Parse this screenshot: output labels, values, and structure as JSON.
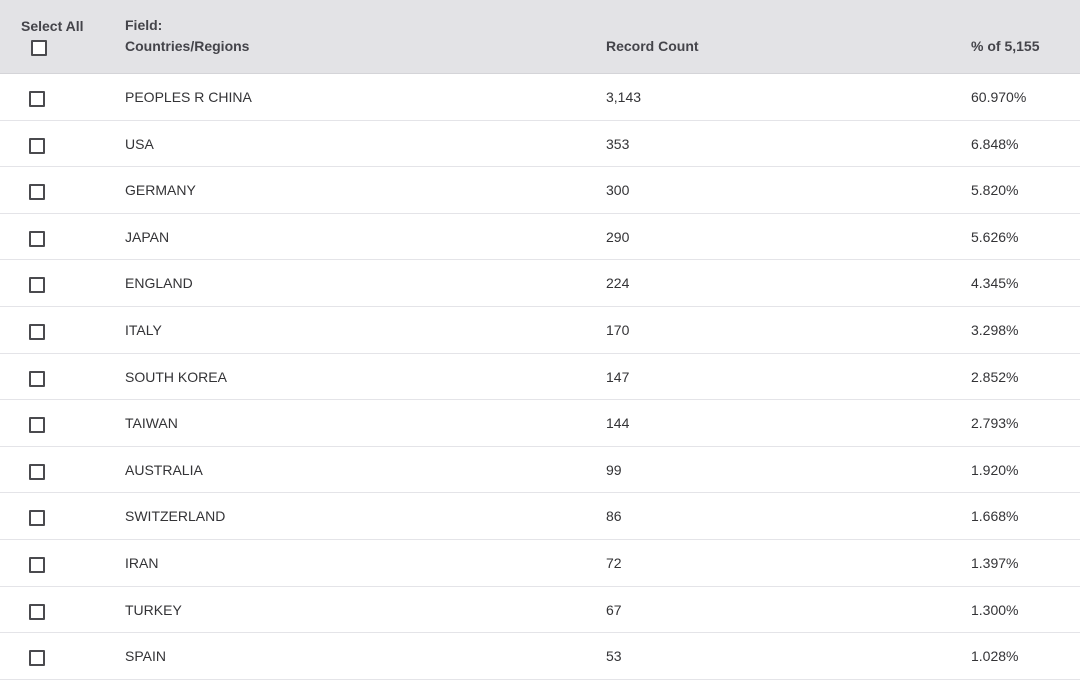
{
  "header": {
    "select_all_label": "Select All",
    "field_label": "Field:",
    "field_value": "Countries/Regions",
    "record_count_label": "Record Count",
    "percent_label": "% of 5,155"
  },
  "rows": [
    {
      "country": "PEOPLES R CHINA",
      "count": "3,143",
      "percent": "60.970%"
    },
    {
      "country": "USA",
      "count": "353",
      "percent": "6.848%"
    },
    {
      "country": "GERMANY",
      "count": "300",
      "percent": "5.820%"
    },
    {
      "country": "JAPAN",
      "count": "290",
      "percent": "5.626%"
    },
    {
      "country": "ENGLAND",
      "count": "224",
      "percent": "4.345%"
    },
    {
      "country": "ITALY",
      "count": "170",
      "percent": "3.298%"
    },
    {
      "country": "SOUTH KOREA",
      "count": "147",
      "percent": "2.852%"
    },
    {
      "country": "TAIWAN",
      "count": "144",
      "percent": "2.793%"
    },
    {
      "country": "AUSTRALIA",
      "count": "99",
      "percent": "1.920%"
    },
    {
      "country": "SWITZERLAND",
      "count": "86",
      "percent": "1.668%"
    },
    {
      "country": "IRAN",
      "count": "72",
      "percent": "1.397%"
    },
    {
      "country": "TURKEY",
      "count": "67",
      "percent": "1.300%"
    },
    {
      "country": "SPAIN",
      "count": "53",
      "percent": "1.028%"
    }
  ]
}
